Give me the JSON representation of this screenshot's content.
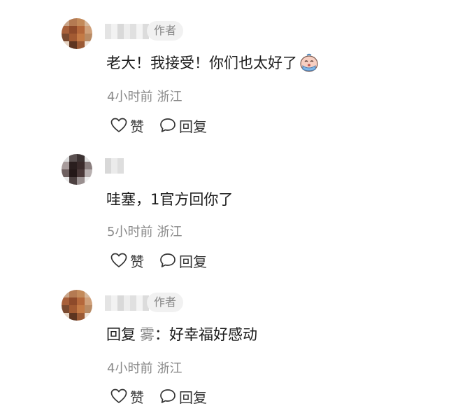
{
  "comments": [
    {
      "badge": "作者",
      "text_prefix": "",
      "text_mention": "",
      "text": "老大！我接受！你们也太好了",
      "emoji_icon": "crying-face-emoji-icon",
      "time": "4小时前",
      "location": "浙江",
      "like_label": "赞",
      "reply_label": "回复"
    },
    {
      "badge": "",
      "text_prefix": "",
      "text_mention": "",
      "text": "哇塞，1官方回你了",
      "time": "5小时前",
      "location": "浙江",
      "like_label": "赞",
      "reply_label": "回复"
    },
    {
      "badge": "作者",
      "text_prefix": "回复",
      "text_mention": "雾",
      "text": "：好幸福好感动",
      "time": "4小时前",
      "location": "浙江",
      "like_label": "赞",
      "reply_label": "回复"
    }
  ],
  "colors": {
    "meta_text": "#8a8a8a",
    "badge_bg": "#f1f1f1",
    "badge_text": "#888888"
  }
}
